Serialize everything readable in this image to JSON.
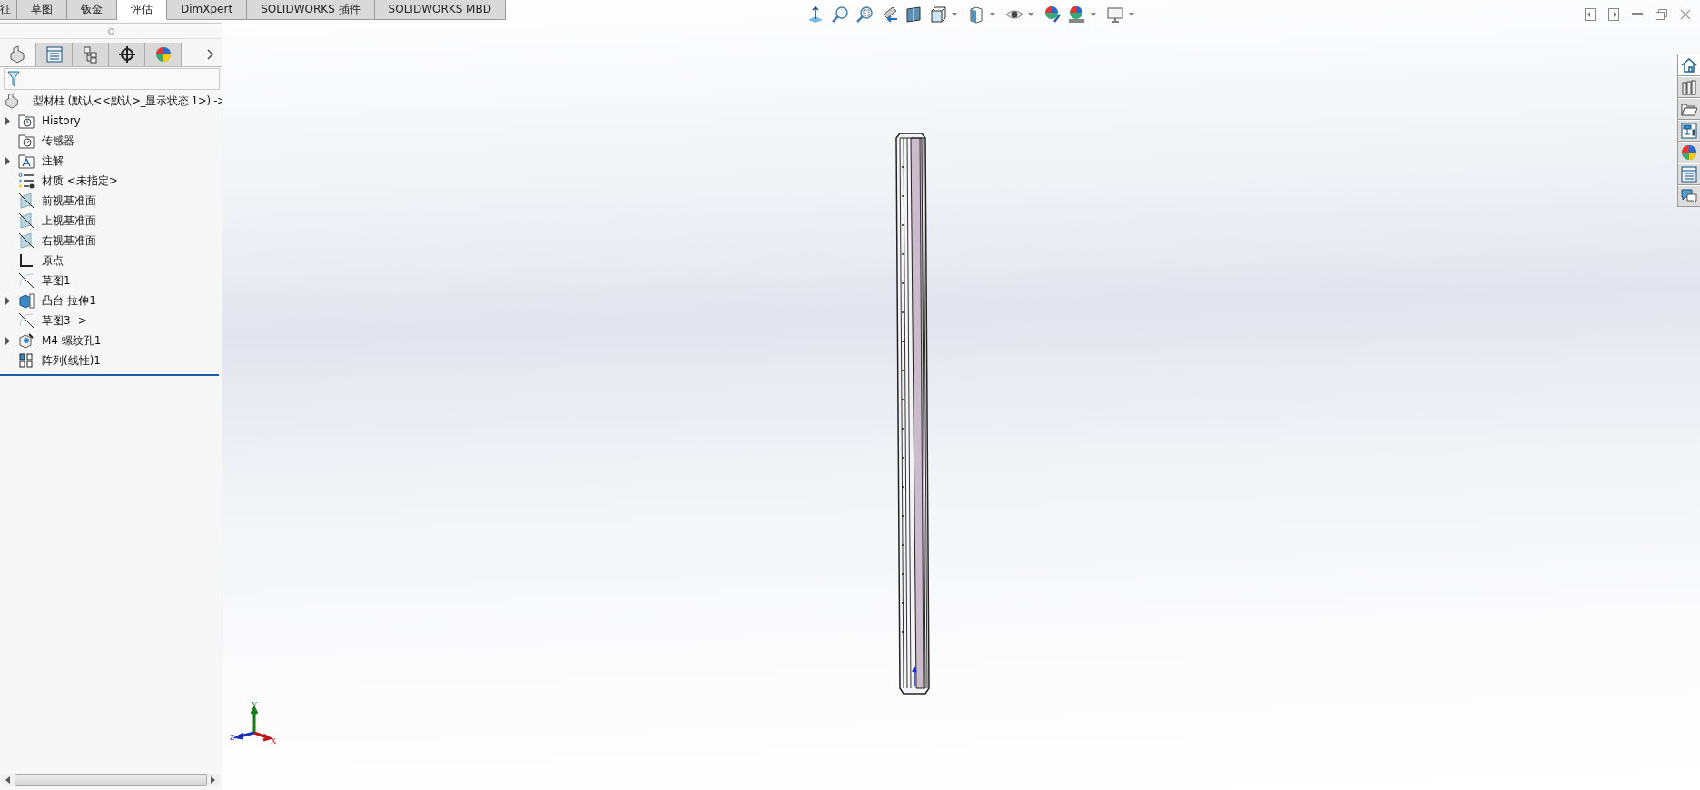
{
  "command_tabs": [
    {
      "label": "征",
      "selected": false
    },
    {
      "label": "草图",
      "selected": false
    },
    {
      "label": "钣金",
      "selected": false
    },
    {
      "label": "评估",
      "selected": true
    },
    {
      "label": "DimXpert",
      "selected": false
    },
    {
      "label": "SOLIDWORKS 插件",
      "selected": false
    },
    {
      "label": "SOLIDWORKS MBD",
      "selected": false
    }
  ],
  "manager_tabs": [
    {
      "kind": "part",
      "selected": true
    },
    {
      "kind": "property",
      "selected": false
    },
    {
      "kind": "config",
      "selected": false
    },
    {
      "kind": "dimxpert",
      "selected": false
    },
    {
      "kind": "display",
      "selected": false
    }
  ],
  "feature_tree": {
    "label": "型材柱  (默认<<默认>_显示状态 1>) ->",
    "children": [
      {
        "label": "History",
        "kind": "history",
        "collapsible": true
      },
      {
        "label": "传感器",
        "kind": "sensor",
        "collapsible": false
      },
      {
        "label": "注解",
        "kind": "annotation",
        "collapsible": true
      },
      {
        "label": "材质 <未指定>",
        "kind": "material",
        "collapsible": false
      },
      {
        "label": "前视基准面",
        "kind": "plane",
        "collapsible": false
      },
      {
        "label": "上视基准面",
        "kind": "plane",
        "collapsible": false
      },
      {
        "label": "右视基准面",
        "kind": "plane",
        "collapsible": false
      },
      {
        "label": "原点",
        "kind": "origin",
        "collapsible": false
      },
      {
        "label": "草图1",
        "kind": "sketch",
        "collapsible": false
      },
      {
        "label": "凸台-拉伸1",
        "kind": "extrude",
        "collapsible": true
      },
      {
        "label": "草图3 ->",
        "kind": "sketch",
        "collapsible": false
      },
      {
        "label": "M4 螺纹孔1",
        "kind": "hole",
        "collapsible": true
      },
      {
        "label": "阵列(线性)1",
        "kind": "pattern",
        "collapsible": false
      }
    ]
  },
  "view_toolbar": [
    {
      "kind": "normal",
      "dropdown": false
    },
    {
      "kind": "zoom-fit",
      "dropdown": false
    },
    {
      "kind": "zoom-area",
      "dropdown": false
    },
    {
      "kind": "previous",
      "dropdown": false
    },
    {
      "kind": "section",
      "dropdown": false
    },
    {
      "kind": "orientation",
      "dropdown": true
    },
    {
      "kind": "display-style",
      "dropdown": true
    },
    {
      "kind": "hide-show",
      "dropdown": true
    },
    {
      "kind": "edit-appearance",
      "dropdown": false
    },
    {
      "kind": "scene",
      "dropdown": true
    },
    {
      "kind": "view-settings",
      "dropdown": true
    }
  ],
  "task_pane": [
    {
      "kind": "home",
      "selected": true
    },
    {
      "kind": "library",
      "selected": false
    },
    {
      "kind": "explorer",
      "selected": false
    },
    {
      "kind": "palette",
      "selected": false
    },
    {
      "kind": "appearances",
      "selected": false
    },
    {
      "kind": "properties",
      "selected": false
    },
    {
      "kind": "forum",
      "selected": false
    }
  ],
  "triad": {
    "x": "X",
    "y": "Y",
    "z": "Z"
  }
}
